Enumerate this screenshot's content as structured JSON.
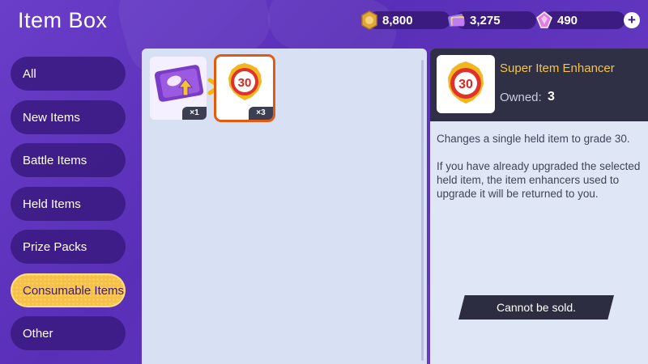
{
  "header": {
    "title": "Item Box"
  },
  "currency": {
    "coins": "8,800",
    "tickets": "3,275",
    "gems": "490",
    "add_label": "+"
  },
  "sidebar": {
    "items": [
      {
        "label": "All",
        "active": false
      },
      {
        "label": "New Items",
        "active": false
      },
      {
        "label": "Battle Items",
        "active": false
      },
      {
        "label": "Held Items",
        "active": false
      },
      {
        "label": "Prize Packs",
        "active": false
      },
      {
        "label": "Consumable Items",
        "active": true
      },
      {
        "label": "Other",
        "active": false
      }
    ]
  },
  "grid": {
    "items": [
      {
        "name": "item-enhancer-ticket",
        "count": "×1"
      },
      {
        "name": "super-item-enhancer",
        "count": "×3",
        "selected": true,
        "badge": "30"
      }
    ]
  },
  "detail": {
    "name": "Super Item Enhancer",
    "owned_label": "Owned:",
    "owned_value": "3",
    "badge": "30",
    "description_1": "Changes a single held item to grade 30.",
    "description_2": "If you have already upgraded the selected held item, the item enhancers used to upgrade it will be returned to you.",
    "note": "Cannot be sold."
  },
  "colors": {
    "background": "#6a3ec8",
    "accent": "#f6c144",
    "selected_border": "#e55a12",
    "panel": "#d8e0f4"
  }
}
